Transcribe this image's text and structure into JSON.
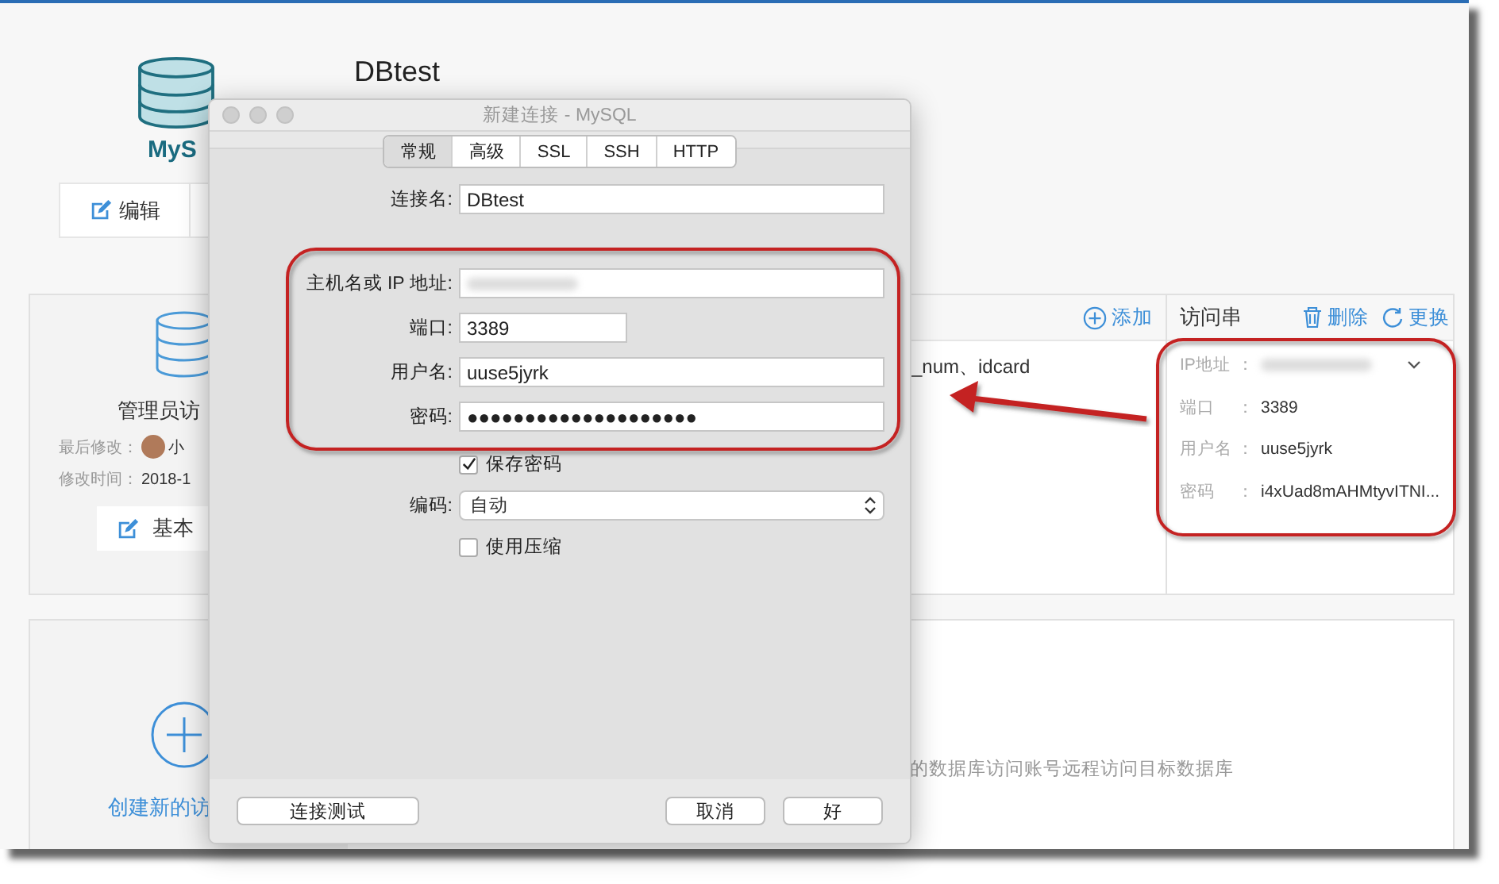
{
  "page": {
    "logo_text": "MyS",
    "title": "DBtest",
    "actions": [
      {
        "label": "编辑"
      }
    ]
  },
  "admin_panel": {
    "name": "管理员访",
    "modified_by_label": "最后修改：",
    "modified_by": "小",
    "modified_time_label": "修改时间：",
    "modified_time": "2018-1",
    "button": "基本"
  },
  "fields_column": {
    "add_button": "添加",
    "fields_text": "_num、idcard"
  },
  "access_string": {
    "title": "访问串",
    "delete_button": "删除",
    "refresh_button": "更换",
    "rows": [
      {
        "kind": "masked",
        "label": "IP地址",
        "colon": "："
      },
      {
        "kind": "text",
        "label": "端口",
        "colon": "：",
        "value": "3389"
      },
      {
        "kind": "text",
        "label": "用户名",
        "colon": "：",
        "value": "uuse5jyrk"
      },
      {
        "kind": "text",
        "label": "密码",
        "colon": "：",
        "value": "i4xUad8mAHMtyvITNI..."
      }
    ]
  },
  "create_panel": {
    "label": "创建新的访",
    "description": "的数据库访问账号远程访问目标数据库"
  },
  "dialog": {
    "title": "新建连接 - MySQL",
    "tabs": [
      {
        "label": "常规",
        "selected": true
      },
      {
        "label": "高级",
        "selected": false
      },
      {
        "label": "SSL",
        "selected": false
      },
      {
        "label": "SSH",
        "selected": false
      },
      {
        "label": "HTTP",
        "selected": false
      }
    ],
    "connection_name": {
      "label": "连接名:",
      "value": "DBtest"
    },
    "server_fields": [
      {
        "kind": "masked",
        "label": "主机名或 IP 地址:"
      },
      {
        "kind": "short",
        "label": "端口:",
        "value": "3389"
      },
      {
        "kind": "text",
        "label": "用户名:",
        "value": "uuse5jyrk"
      },
      {
        "kind": "text",
        "label": "密码:",
        "value": "●●●●●●●●●●●●●●●●●●●●"
      }
    ],
    "options": [
      {
        "kind": "checkbox",
        "label": "保存密码",
        "checked": true
      },
      {
        "kind": "select",
        "label": "编码:",
        "value": "自动"
      },
      {
        "kind": "checkbox",
        "label": "使用压缩",
        "checked": false
      }
    ],
    "test_button": "连接测试",
    "buttons": [
      "取消",
      "好"
    ]
  }
}
